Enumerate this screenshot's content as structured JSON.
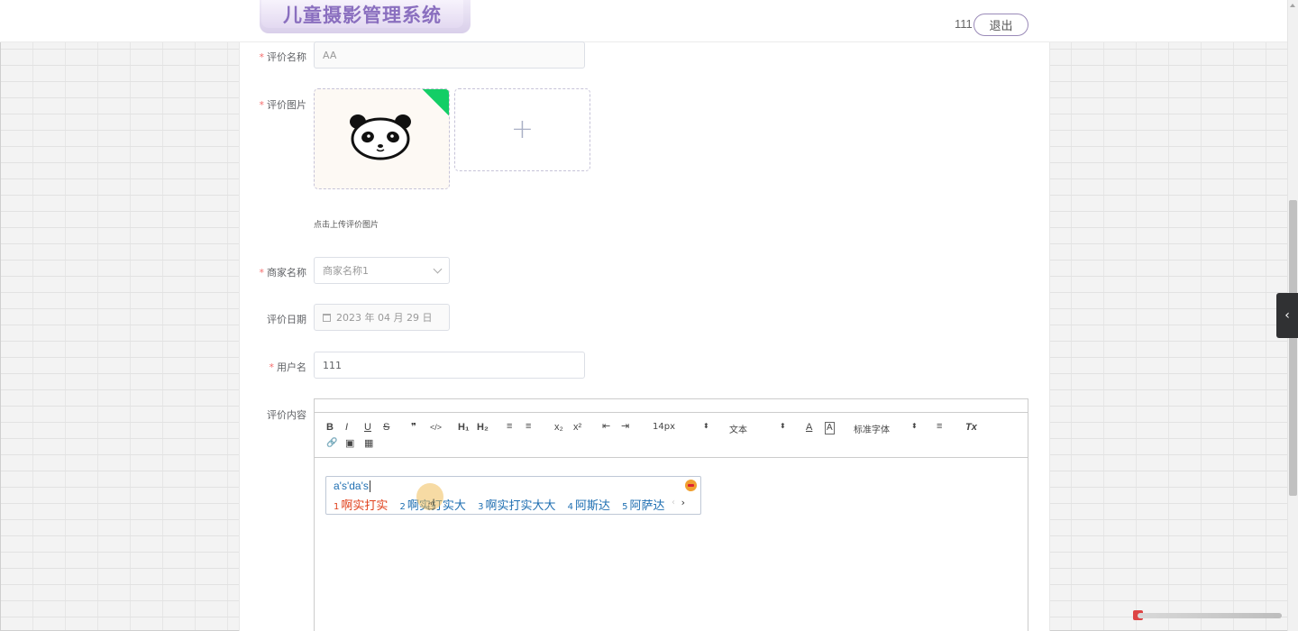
{
  "header": {
    "title": "儿童摄影管理系统",
    "user": "111",
    "logout": "退出"
  },
  "form": {
    "review_name": {
      "label": "评价名称",
      "value": "AA"
    },
    "review_image": {
      "label": "评价图片",
      "hint": "点击上传评价图片",
      "add": "+"
    },
    "merchant_name": {
      "label": "商家名称",
      "value": "商家名称1"
    },
    "review_date": {
      "label": "评价日期",
      "value": "2023 年 04 月 29 日"
    },
    "username": {
      "label": "用户名",
      "value": "111"
    },
    "review_content": {
      "label": "评价内容"
    }
  },
  "required_mark": "*",
  "toolbar": {
    "bold": "B",
    "italic": "I",
    "underline": "U",
    "strike": "S",
    "quote": "❞",
    "code": "</>",
    "h1": "H₁",
    "h2": "H₂",
    "ol": "≡",
    "ul": "≡",
    "sub": "x₂",
    "sup": "x²",
    "outdent": "⇤",
    "indent": "⇥",
    "size": "14px",
    "header": "文本",
    "color": "A",
    "bg": "A",
    "font": "标准字体",
    "align": "≡",
    "clean": "Tx",
    "link": "🔗",
    "image": "▣",
    "video": "▦"
  },
  "ime": {
    "input": "a's'da's",
    "candidates": [
      {
        "num": "1",
        "text": "啊实打实"
      },
      {
        "num": "2",
        "text": "啊实打实大"
      },
      {
        "num": "3",
        "text": "啊实打实大大"
      },
      {
        "num": "4",
        "text": "阿斯达"
      },
      {
        "num": "5",
        "text": "阿萨达"
      }
    ],
    "prev": "‹",
    "next": "›"
  },
  "side_tab": "‹",
  "colors": {
    "brand": "#8a6fbf",
    "required": "#f56c6c",
    "accent_green": "#13ce66",
    "ime_blue": "#1f6fb2",
    "ime_active": "#e0401c"
  }
}
